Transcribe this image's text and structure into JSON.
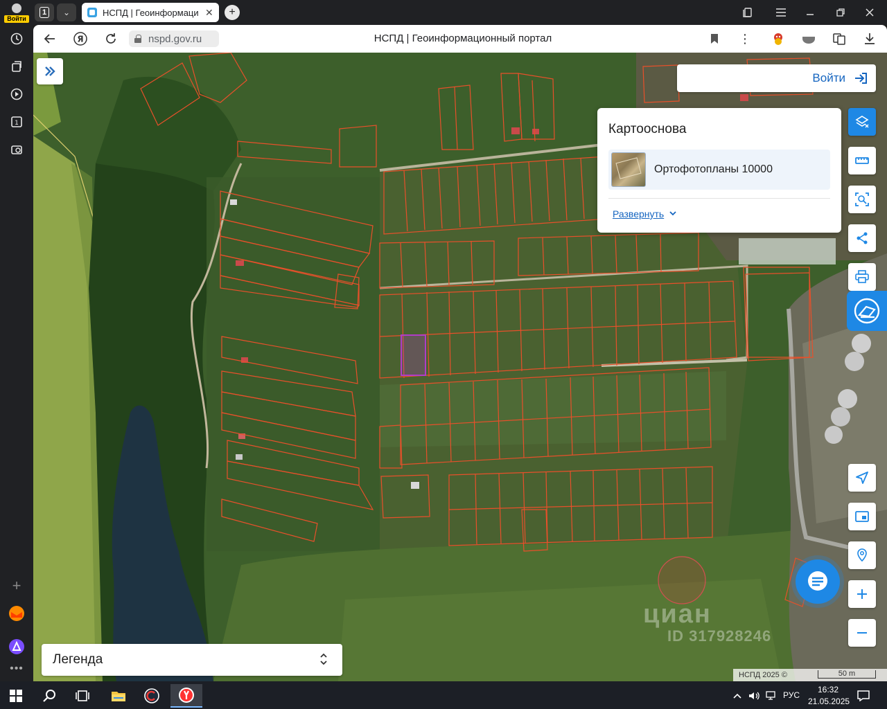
{
  "browser": {
    "profile_badge": "Войти",
    "tab_count": "1",
    "tab_title": "НСПД | Геоинформаци",
    "tab_close": "✕",
    "new_tab": "+",
    "url": "nspd.gov.ru",
    "page_title": "НСПД | Геоинформационный портал",
    "yandex_btn": "Я"
  },
  "map": {
    "login_label": "Войти",
    "basemap": {
      "title": "Картооснова",
      "item": "Ортофотопланы 10000",
      "expand": "Развернуть"
    },
    "legend_label": "Легенда",
    "watermark": "циан",
    "watermark_id": "ID 317928246",
    "attribution": "НСПД 2025 ©",
    "scale": "50 m"
  },
  "taskbar": {
    "lang": "РУС",
    "time": "16:32",
    "date": "21.05.2025"
  },
  "colors": {
    "accent": "#1e88e5",
    "parcel": "#e8502a",
    "selected_parcel": "#b03cc8"
  }
}
